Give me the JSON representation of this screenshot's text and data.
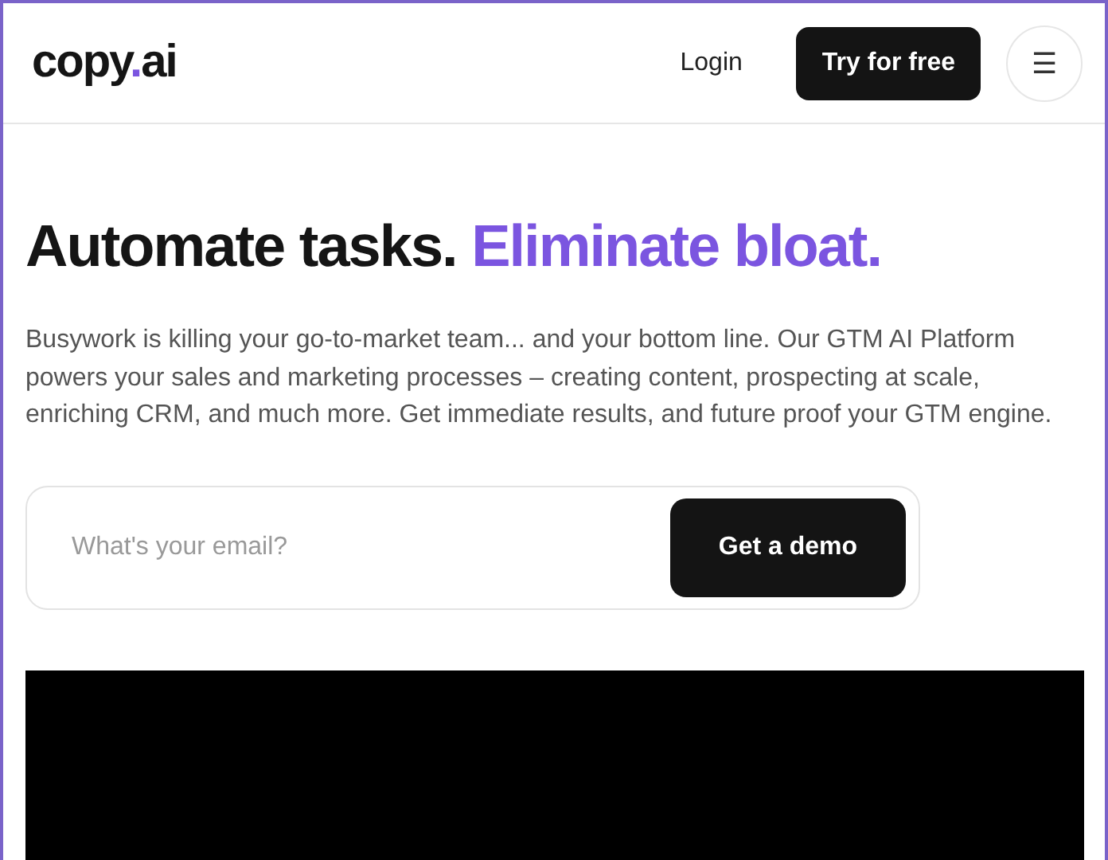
{
  "header": {
    "logo": {
      "start": "copy",
      "dot": ".",
      "end": "ai"
    },
    "login": "Login",
    "cta": "Try for free",
    "menu_icon": "☰"
  },
  "hero": {
    "headline": "Automate tasks.",
    "headline_accent": "Eliminate bloat.",
    "description": "Busywork is killing your go-to-market team... and your bottom line. Our GTM AI Platform powers your sales and marketing processes – creating content, prospecting at scale, enriching CRM, and much more. Get immediate results, and future proof your GTM engine.",
    "email_placeholder": "What's your email?",
    "demo_button": "Get a demo"
  }
}
